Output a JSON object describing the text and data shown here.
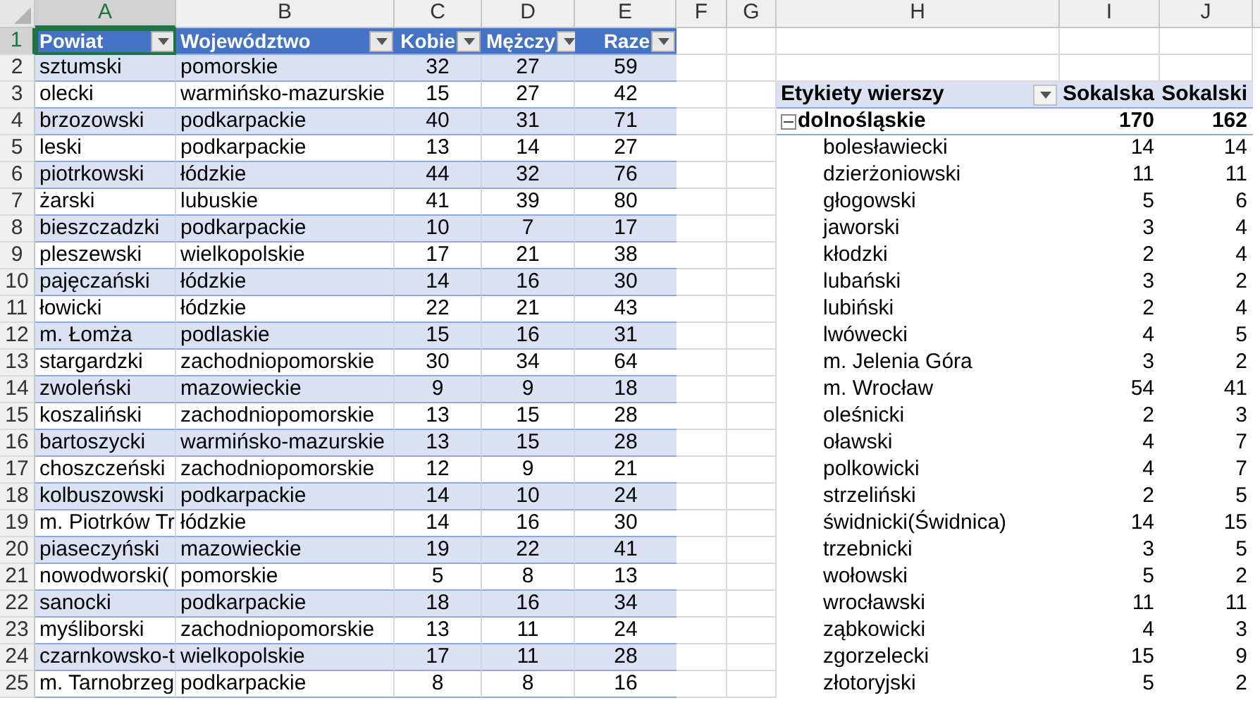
{
  "column_headers": [
    {
      "label": "A",
      "selected": true
    },
    {
      "label": "B",
      "selected": false
    },
    {
      "label": "C",
      "selected": false
    },
    {
      "label": "D",
      "selected": false
    },
    {
      "label": "E",
      "selected": false
    },
    {
      "label": "F",
      "selected": false
    },
    {
      "label": "G",
      "selected": false
    },
    {
      "label": "H",
      "selected": false
    },
    {
      "label": "I",
      "selected": false
    },
    {
      "label": "J",
      "selected": false
    }
  ],
  "row_headers": [
    {
      "label": "1",
      "selected": true
    },
    {
      "label": "2",
      "selected": false
    },
    {
      "label": "3",
      "selected": false
    },
    {
      "label": "4",
      "selected": false
    },
    {
      "label": "5",
      "selected": false
    },
    {
      "label": "6",
      "selected": false
    },
    {
      "label": "7",
      "selected": false
    },
    {
      "label": "8",
      "selected": false
    },
    {
      "label": "9",
      "selected": false
    },
    {
      "label": "10",
      "selected": false
    },
    {
      "label": "11",
      "selected": false
    },
    {
      "label": "12",
      "selected": false
    },
    {
      "label": "13",
      "selected": false
    },
    {
      "label": "14",
      "selected": false
    },
    {
      "label": "15",
      "selected": false
    },
    {
      "label": "16",
      "selected": false
    },
    {
      "label": "17",
      "selected": false
    },
    {
      "label": "18",
      "selected": false
    },
    {
      "label": "19",
      "selected": false
    },
    {
      "label": "20",
      "selected": false
    },
    {
      "label": "21",
      "selected": false
    },
    {
      "label": "22",
      "selected": false
    },
    {
      "label": "23",
      "selected": false
    },
    {
      "label": "24",
      "selected": false
    },
    {
      "label": "25",
      "selected": false
    }
  ],
  "table": {
    "columns": [
      {
        "label": "Powiat",
        "selected": true
      },
      {
        "label": "Województwo",
        "selected": false
      },
      {
        "label": "Kobie",
        "selected": false
      },
      {
        "label": "Mężczy",
        "selected": false
      },
      {
        "label": "Raze",
        "selected": false
      }
    ],
    "rows": [
      [
        "sztumski",
        "pomorskie",
        "32",
        "27",
        "59"
      ],
      [
        "olecki",
        "warmińsko-mazurskie",
        "15",
        "27",
        "42"
      ],
      [
        "brzozowski",
        "podkarpackie",
        "40",
        "31",
        "71"
      ],
      [
        "leski",
        "podkarpackie",
        "13",
        "14",
        "27"
      ],
      [
        "piotrkowski",
        "łódzkie",
        "44",
        "32",
        "76"
      ],
      [
        "żarski",
        "lubuskie",
        "41",
        "39",
        "80"
      ],
      [
        "bieszczadzki",
        "podkarpackie",
        "10",
        "7",
        "17"
      ],
      [
        "pleszewski",
        "wielkopolskie",
        "17",
        "21",
        "38"
      ],
      [
        "pajęczański",
        "łódzkie",
        "14",
        "16",
        "30"
      ],
      [
        "łowicki",
        "łódzkie",
        "22",
        "21",
        "43"
      ],
      [
        "m. Łomża",
        "podlaskie",
        "15",
        "16",
        "31"
      ],
      [
        "stargardzki",
        "zachodniopomorskie",
        "30",
        "34",
        "64"
      ],
      [
        "zwoleński",
        "mazowieckie",
        "9",
        "9",
        "18"
      ],
      [
        "koszaliński",
        "zachodniopomorskie",
        "13",
        "15",
        "28"
      ],
      [
        "bartoszycki",
        "warmińsko-mazurskie",
        "13",
        "15",
        "28"
      ],
      [
        "choszczeński",
        "zachodniopomorskie",
        "12",
        "9",
        "21"
      ],
      [
        "kolbuszowski",
        "podkarpackie",
        "14",
        "10",
        "24"
      ],
      [
        "m. Piotrków Tr",
        "łódzkie",
        "14",
        "16",
        "30"
      ],
      [
        "piaseczyński",
        "mazowieckie",
        "19",
        "22",
        "41"
      ],
      [
        "nowodworski(",
        "pomorskie",
        "5",
        "8",
        "13"
      ],
      [
        "sanocki",
        "podkarpackie",
        "18",
        "16",
        "34"
      ],
      [
        "myśliborski",
        "zachodniopomorskie",
        "13",
        "11",
        "24"
      ],
      [
        "czarnkowsko-t",
        "wielkopolskie",
        "17",
        "11",
        "28"
      ],
      [
        "m. Tarnobrzeg",
        "podkarpackie",
        "8",
        "8",
        "16"
      ]
    ]
  },
  "pivot": {
    "row_label_header": "Etykiety wierszy",
    "value_headers": [
      "Sokalska",
      "Sokalski"
    ],
    "groups": [
      {
        "label": "dolnośląskie",
        "expanded": true,
        "values": [
          "170",
          "162"
        ],
        "children": [
          {
            "label": "bolesławiecki",
            "values": [
              "14",
              "14"
            ]
          },
          {
            "label": "dzierżoniowski",
            "values": [
              "11",
              "11"
            ]
          },
          {
            "label": "głogowski",
            "values": [
              "5",
              "6"
            ]
          },
          {
            "label": "jaworski",
            "values": [
              "3",
              "4"
            ]
          },
          {
            "label": "kłodzki",
            "values": [
              "2",
              "4"
            ]
          },
          {
            "label": "lubański",
            "values": [
              "3",
              "2"
            ]
          },
          {
            "label": "lubiński",
            "values": [
              "2",
              "4"
            ]
          },
          {
            "label": "lwówecki",
            "values": [
              "4",
              "5"
            ]
          },
          {
            "label": "m. Jelenia Góra",
            "values": [
              "3",
              "2"
            ]
          },
          {
            "label": "m. Wrocław",
            "values": [
              "54",
              "41"
            ]
          },
          {
            "label": "oleśnicki",
            "values": [
              "2",
              "3"
            ]
          },
          {
            "label": "oławski",
            "values": [
              "4",
              "7"
            ]
          },
          {
            "label": "polkowicki",
            "values": [
              "4",
              "7"
            ]
          },
          {
            "label": "strzeliński",
            "values": [
              "2",
              "5"
            ]
          },
          {
            "label": "świdnicki(Świdnica)",
            "values": [
              "14",
              "15"
            ]
          },
          {
            "label": "trzebnicki",
            "values": [
              "3",
              "5"
            ]
          },
          {
            "label": "wołowski",
            "values": [
              "5",
              "2"
            ]
          },
          {
            "label": "wrocławski",
            "values": [
              "11",
              "11"
            ]
          },
          {
            "label": "ząbkowicki",
            "values": [
              "4",
              "3"
            ]
          },
          {
            "label": "zgorzelecki",
            "values": [
              "15",
              "9"
            ]
          },
          {
            "label": "złotoryjski",
            "values": [
              "5",
              "2"
            ]
          }
        ]
      }
    ]
  }
}
